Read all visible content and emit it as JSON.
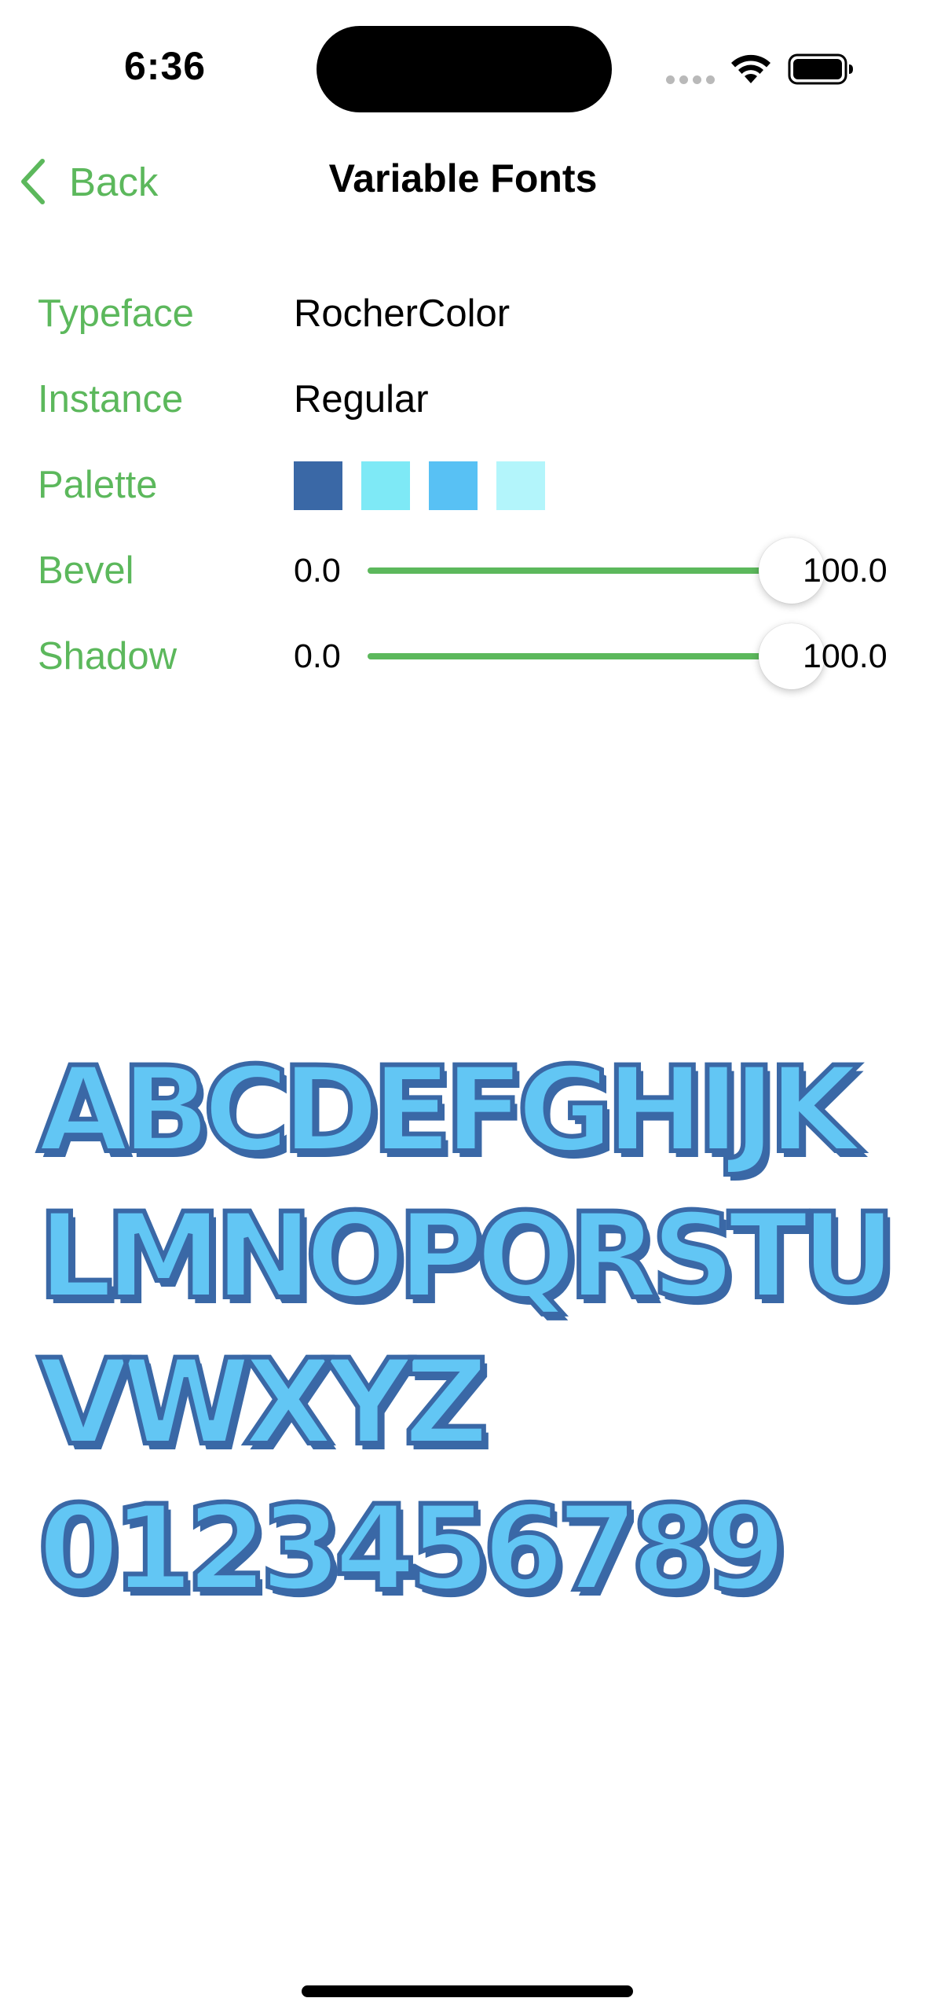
{
  "status_bar": {
    "time": "6:36"
  },
  "nav": {
    "back_label": "Back",
    "title": "Variable Fonts"
  },
  "settings": {
    "typeface": {
      "label": "Typeface",
      "value": "RocherColor"
    },
    "instance": {
      "label": "Instance",
      "value": "Regular"
    },
    "palette": {
      "label": "Palette",
      "colors": [
        "#3a68a6",
        "#7ee9f6",
        "#58c1f4",
        "#b3f5fb"
      ]
    },
    "bevel": {
      "label": "Bevel",
      "min": "0.0",
      "max": "100.0",
      "value": 100
    },
    "shadow": {
      "label": "Shadow",
      "min": "0.0",
      "max": "100.0",
      "value": 100
    }
  },
  "preview": {
    "lines": [
      "ABCDEFGHIJK",
      "LMNOPQRSTU",
      "VWXYZ",
      "0123456789"
    ],
    "fill_color": "#62c6f4",
    "outline_color": "#3a68a6"
  },
  "colors": {
    "accent": "#5cb85c"
  }
}
